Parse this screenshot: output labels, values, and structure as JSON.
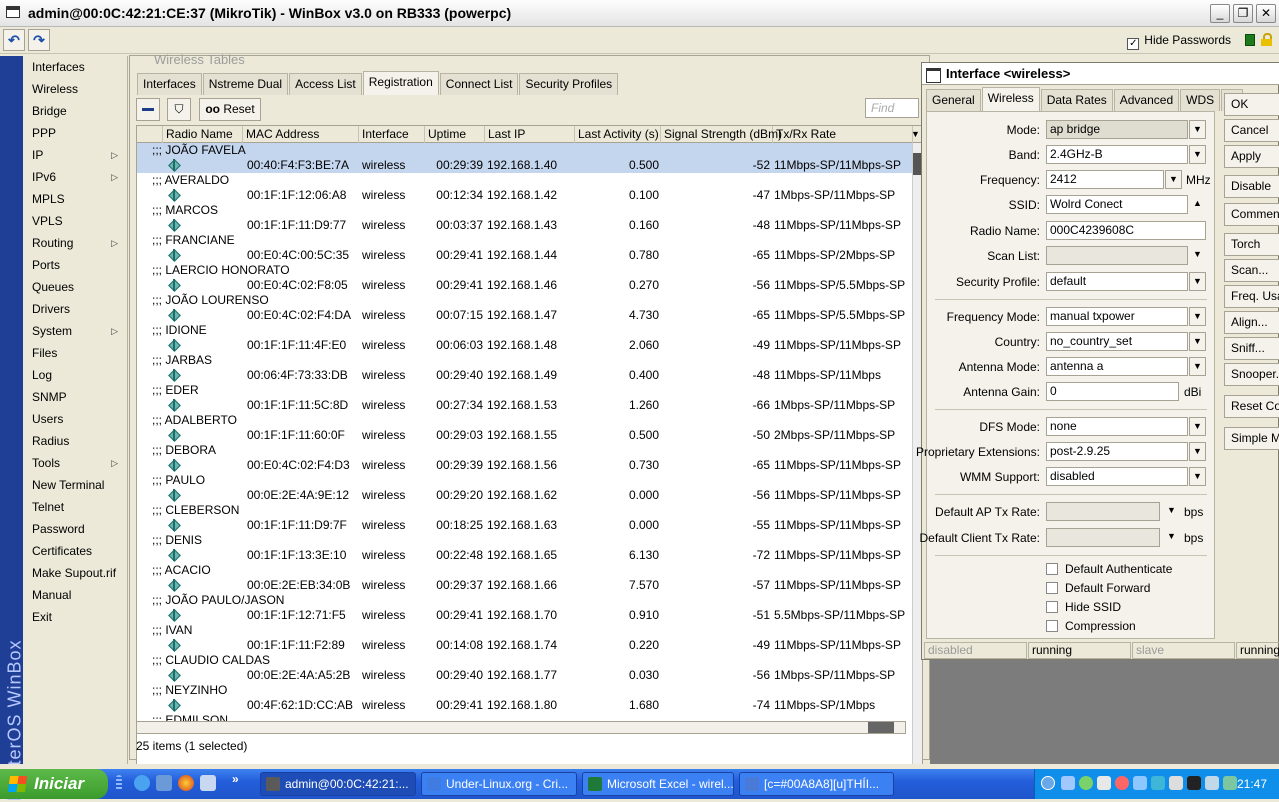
{
  "window": {
    "title": "admin@00:0C:42:21:CE:37 (MikroTik) - WinBox v3.0 on RB333 (powerpc)",
    "hide_passwords": "Hide Passwords"
  },
  "sidebar": {
    "brand": "RouterOS WinBox",
    "items": [
      {
        "label": "Interfaces",
        "sub": false
      },
      {
        "label": "Wireless",
        "sub": false
      },
      {
        "label": "Bridge",
        "sub": false
      },
      {
        "label": "PPP",
        "sub": false
      },
      {
        "label": "IP",
        "sub": true
      },
      {
        "label": "IPv6",
        "sub": true
      },
      {
        "label": "MPLS",
        "sub": false
      },
      {
        "label": "VPLS",
        "sub": false
      },
      {
        "label": "Routing",
        "sub": true
      },
      {
        "label": "Ports",
        "sub": false
      },
      {
        "label": "Queues",
        "sub": false
      },
      {
        "label": "Drivers",
        "sub": false
      },
      {
        "label": "System",
        "sub": true
      },
      {
        "label": "Files",
        "sub": false
      },
      {
        "label": "Log",
        "sub": false
      },
      {
        "label": "SNMP",
        "sub": false
      },
      {
        "label": "Users",
        "sub": false
      },
      {
        "label": "Radius",
        "sub": false
      },
      {
        "label": "Tools",
        "sub": true
      },
      {
        "label": "New Terminal",
        "sub": false
      },
      {
        "label": "Telnet",
        "sub": false
      },
      {
        "label": "Password",
        "sub": false
      },
      {
        "label": "Certificates",
        "sub": false
      },
      {
        "label": "Make Supout.rif",
        "sub": false
      },
      {
        "label": "Manual",
        "sub": false
      },
      {
        "label": "Exit",
        "sub": false
      }
    ]
  },
  "wireless_tables": {
    "title": "Wireless Tables",
    "tabs": [
      "Interfaces",
      "Nstreme Dual",
      "Access List",
      "Registration",
      "Connect List",
      "Security Profiles"
    ],
    "active_tab": "Registration",
    "reset_label": "Reset",
    "reset_prefix": "oo",
    "find_placeholder": "Find",
    "columns": [
      "Radio Name",
      "MAC Address",
      "Interface",
      "Uptime",
      "Last IP",
      "Last Activity (s)",
      "Signal Strength (dBm)",
      "Tx/Rx Rate"
    ],
    "rows": [
      {
        "comment": ";;; JOÃO FAVELA",
        "mac": "00:40:F4:F3:BE:7A",
        "iface": "wireless",
        "uptime": "00:29:39",
        "ip": "192.168.1.40",
        "activity": "0.500",
        "signal": "-52",
        "rate": "11Mbps-SP/11Mbps-SP",
        "selected": true
      },
      {
        "comment": ";;; AVERALDO",
        "mac": "00:1F:1F:12:06:A8",
        "iface": "wireless",
        "uptime": "00:12:34",
        "ip": "192.168.1.42",
        "activity": "0.100",
        "signal": "-47",
        "rate": "1Mbps-SP/11Mbps-SP",
        "selected": false
      },
      {
        "comment": ";;; MARCOS",
        "mac": "00:1F:1F:11:D9:77",
        "iface": "wireless",
        "uptime": "00:03:37",
        "ip": "192.168.1.43",
        "activity": "0.160",
        "signal": "-48",
        "rate": "11Mbps-SP/11Mbps-SP",
        "selected": false
      },
      {
        "comment": ";;; FRANCIANE",
        "mac": "00:E0:4C:00:5C:35",
        "iface": "wireless",
        "uptime": "00:29:41",
        "ip": "192.168.1.44",
        "activity": "0.780",
        "signal": "-65",
        "rate": "11Mbps-SP/2Mbps-SP",
        "selected": false
      },
      {
        "comment": ";;; LAERCIO HONORATO",
        "mac": "00:E0:4C:02:F8:05",
        "iface": "wireless",
        "uptime": "00:29:41",
        "ip": "192.168.1.46",
        "activity": "0.270",
        "signal": "-56",
        "rate": "11Mbps-SP/5.5Mbps-SP",
        "selected": false
      },
      {
        "comment": ";;; JOÃO LOURENSO",
        "mac": "00:E0:4C:02:F4:DA",
        "iface": "wireless",
        "uptime": "00:07:15",
        "ip": "192.168.1.47",
        "activity": "4.730",
        "signal": "-65",
        "rate": "11Mbps-SP/5.5Mbps-SP",
        "selected": false
      },
      {
        "comment": ";;; IDIONE",
        "mac": "00:1F:1F:11:4F:E0",
        "iface": "wireless",
        "uptime": "00:06:03",
        "ip": "192.168.1.48",
        "activity": "2.060",
        "signal": "-49",
        "rate": "11Mbps-SP/11Mbps-SP",
        "selected": false
      },
      {
        "comment": ";;; JARBAS",
        "mac": "00:06:4F:73:33:DB",
        "iface": "wireless",
        "uptime": "00:29:40",
        "ip": "192.168.1.49",
        "activity": "0.400",
        "signal": "-48",
        "rate": "11Mbps-SP/11Mbps",
        "selected": false
      },
      {
        "comment": ";;; EDER",
        "mac": "00:1F:1F:11:5C:8D",
        "iface": "wireless",
        "uptime": "00:27:34",
        "ip": "192.168.1.53",
        "activity": "1.260",
        "signal": "-66",
        "rate": "1Mbps-SP/11Mbps-SP",
        "selected": false
      },
      {
        "comment": ";;; ADALBERTO",
        "mac": "00:1F:1F:11:60:0F",
        "iface": "wireless",
        "uptime": "00:29:03",
        "ip": "192.168.1.55",
        "activity": "0.500",
        "signal": "-50",
        "rate": "2Mbps-SP/11Mbps-SP",
        "selected": false
      },
      {
        "comment": ";;; DEBORA",
        "mac": "00:E0:4C:02:F4:D3",
        "iface": "wireless",
        "uptime": "00:29:39",
        "ip": "192.168.1.56",
        "activity": "0.730",
        "signal": "-65",
        "rate": "11Mbps-SP/11Mbps-SP",
        "selected": false
      },
      {
        "comment": ";;; PAULO",
        "mac": "00:0E:2E:4A:9E:12",
        "iface": "wireless",
        "uptime": "00:29:20",
        "ip": "192.168.1.62",
        "activity": "0.000",
        "signal": "-56",
        "rate": "11Mbps-SP/11Mbps-SP",
        "selected": false
      },
      {
        "comment": ";;; CLEBERSON",
        "mac": "00:1F:1F:11:D9:7F",
        "iface": "wireless",
        "uptime": "00:18:25",
        "ip": "192.168.1.63",
        "activity": "0.000",
        "signal": "-55",
        "rate": "11Mbps-SP/11Mbps-SP",
        "selected": false
      },
      {
        "comment": ";;; DENIS",
        "mac": "00:1F:1F:13:3E:10",
        "iface": "wireless",
        "uptime": "00:22:48",
        "ip": "192.168.1.65",
        "activity": "6.130",
        "signal": "-72",
        "rate": "11Mbps-SP/11Mbps-SP",
        "selected": false
      },
      {
        "comment": ";;; ACACIO",
        "mac": "00:0E:2E:EB:34:0B",
        "iface": "wireless",
        "uptime": "00:29:37",
        "ip": "192.168.1.66",
        "activity": "7.570",
        "signal": "-57",
        "rate": "11Mbps-SP/11Mbps-SP",
        "selected": false
      },
      {
        "comment": ";;; JOÃO PAULO/JASON",
        "mac": "00:1F:1F:12:71:F5",
        "iface": "wireless",
        "uptime": "00:29:41",
        "ip": "192.168.1.70",
        "activity": "0.910",
        "signal": "-51",
        "rate": "5.5Mbps-SP/11Mbps-SP",
        "selected": false
      },
      {
        "comment": ";;; IVAN",
        "mac": "00:1F:1F:11:F2:89",
        "iface": "wireless",
        "uptime": "00:14:08",
        "ip": "192.168.1.74",
        "activity": "0.220",
        "signal": "-49",
        "rate": "11Mbps-SP/11Mbps-SP",
        "selected": false
      },
      {
        "comment": ";;; CLAUDIO CALDAS",
        "mac": "00:0E:2E:4A:A5:2B",
        "iface": "wireless",
        "uptime": "00:29:40",
        "ip": "192.168.1.77",
        "activity": "0.030",
        "signal": "-56",
        "rate": "1Mbps-SP/11Mbps-SP",
        "selected": false
      },
      {
        "comment": ";;; NEYZINHO",
        "mac": "00:4F:62:1D:CC:AB",
        "iface": "wireless",
        "uptime": "00:29:41",
        "ip": "192.168.1.80",
        "activity": "1.680",
        "signal": "-74",
        "rate": "11Mbps-SP/1Mbps",
        "selected": false
      }
    ],
    "trailing_comment": ";;; EDMILSON",
    "status": "25 items (1 selected)"
  },
  "interface": {
    "title": "Interface <wireless>",
    "tabs": [
      "General",
      "Wireless",
      "Data Rates",
      "Advanced",
      "WDS",
      "..."
    ],
    "active_tab": "Wireless",
    "fields": {
      "mode": {
        "label": "Mode:",
        "value": "ap bridge"
      },
      "band": {
        "label": "Band:",
        "value": "2.4GHz-B"
      },
      "frequency": {
        "label": "Frequency:",
        "value": "2412",
        "unit": "MHz"
      },
      "ssid": {
        "label": "SSID:",
        "value": "Wolrd Conect"
      },
      "radio_name": {
        "label": "Radio Name:",
        "value": "000C4239608C"
      },
      "scan_list": {
        "label": "Scan List:",
        "value": ""
      },
      "security_profile": {
        "label": "Security Profile:",
        "value": "default"
      },
      "frequency_mode": {
        "label": "Frequency Mode:",
        "value": "manual txpower"
      },
      "country": {
        "label": "Country:",
        "value": "no_country_set"
      },
      "antenna_mode": {
        "label": "Antenna Mode:",
        "value": "antenna a"
      },
      "antenna_gain": {
        "label": "Antenna Gain:",
        "value": "0",
        "unit": "dBi"
      },
      "dfs_mode": {
        "label": "DFS Mode:",
        "value": "none"
      },
      "proprietary_extensions": {
        "label": "Proprietary Extensions:",
        "value": "post-2.9.25"
      },
      "wmm_support": {
        "label": "WMM Support:",
        "value": "disabled"
      },
      "default_ap_tx_rate": {
        "label": "Default AP Tx Rate:",
        "value": "",
        "unit": "bps"
      },
      "default_client_tx_rate": {
        "label": "Default Client Tx Rate:",
        "value": "",
        "unit": "bps"
      }
    },
    "checkboxes": [
      "Default Authenticate",
      "Default Forward",
      "Hide SSID",
      "Compression"
    ],
    "buttons": [
      "OK",
      "Cancel",
      "Apply",
      "Disable",
      "Comment",
      "Torch",
      "Scan...",
      "Freq. Usage...",
      "Align...",
      "Sniff...",
      "Snooper...",
      "Reset Configuration",
      "Simple Mode"
    ],
    "status": [
      "disabled",
      "running",
      "slave",
      "running ap"
    ]
  },
  "taskbar": {
    "start": "Iniciar",
    "tasks": [
      {
        "label": "admin@00:0C:42:21:...",
        "active": true
      },
      {
        "label": "Under-Linux.org - Cri...",
        "active": false
      },
      {
        "label": "Microsoft Excel - wirel...",
        "active": false
      },
      {
        "label": "[c=#00A8A8][u]THÍI...",
        "active": false
      }
    ],
    "clock": "21:47"
  }
}
